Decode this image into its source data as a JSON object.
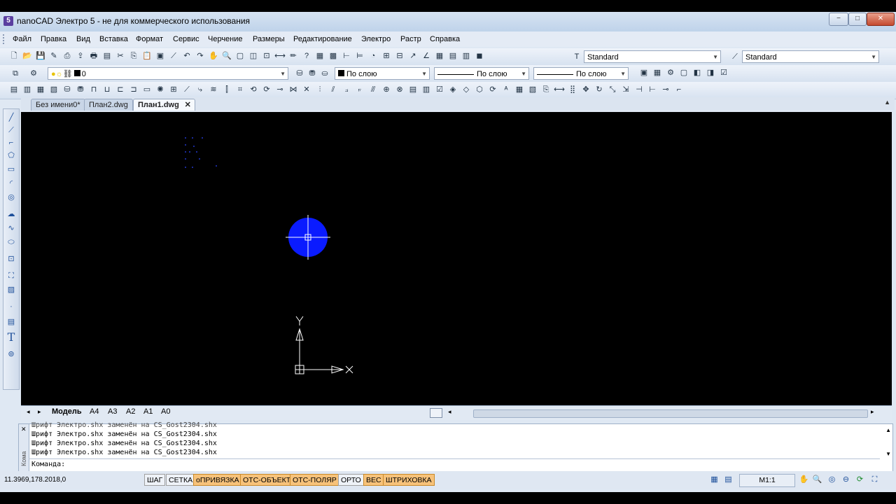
{
  "window": {
    "title": "nanoCAD Электро 5 - не для коммерческого использования",
    "app_icon": "nanocad-logo-icon",
    "minimize": "−",
    "maximize": "□",
    "close": "✕"
  },
  "menu": [
    "Файл",
    "Правка",
    "Вид",
    "Вставка",
    "Формат",
    "Сервис",
    "Черчение",
    "Размеры",
    "Редактирование",
    "Электро",
    "Растр",
    "Справка"
  ],
  "toolbar1": {
    "text_style": "Standard",
    "dim_style": "Standard"
  },
  "toolbar2": {
    "layer": "0",
    "color": "По слою",
    "linetype": "По слою",
    "lineweight": "По слою"
  },
  "doc_tabs": [
    {
      "label": "Без имени0*",
      "active": false
    },
    {
      "label": "План2.dwg",
      "active": false
    },
    {
      "label": "План1.dwg",
      "active": true
    }
  ],
  "doc_tab_close": "✕",
  "ucs": {
    "x_label": "X",
    "y_label": "Y"
  },
  "layout_tabs": [
    {
      "label": "Модель",
      "active": true
    },
    {
      "label": "A4",
      "active": false
    },
    {
      "label": "A3",
      "active": false
    },
    {
      "label": "A2",
      "active": false
    },
    {
      "label": "A1",
      "active": false
    },
    {
      "label": "A0",
      "active": false
    }
  ],
  "command_window": {
    "side_label": "Кома",
    "lines": [
      "Шрифт Электро.shx заменён на CS_Gost2304.shx",
      "Шрифт Электро.shx заменён на CS_Gost2304.shx",
      "Шрифт Электро.shx заменён на CS_Gost2304.shx",
      "Шрифт Электро.shx заменён на CS_Gost2304.shx"
    ],
    "prompt": "Команда:"
  },
  "status": {
    "coords": "11.3969,178.2018,0",
    "buttons": [
      {
        "label": "ШАГ",
        "on": false
      },
      {
        "label": "СЕТКА",
        "on": false
      },
      {
        "label": "оПРИВЯЗКА",
        "on": true
      },
      {
        "label": "ОТС-ОБЪЕКТ",
        "on": true
      },
      {
        "label": "ОТС-ПОЛЯР",
        "on": true
      },
      {
        "label": "ОРТО",
        "on": false
      },
      {
        "label": "ВЕС",
        "on": true
      },
      {
        "label": "ШТРИХОВКА",
        "on": true
      }
    ],
    "scale": "M1:1"
  },
  "colors": {
    "circle": "#0a1bff",
    "cursor": "#ffffff",
    "status_on": "#f7c27a"
  }
}
